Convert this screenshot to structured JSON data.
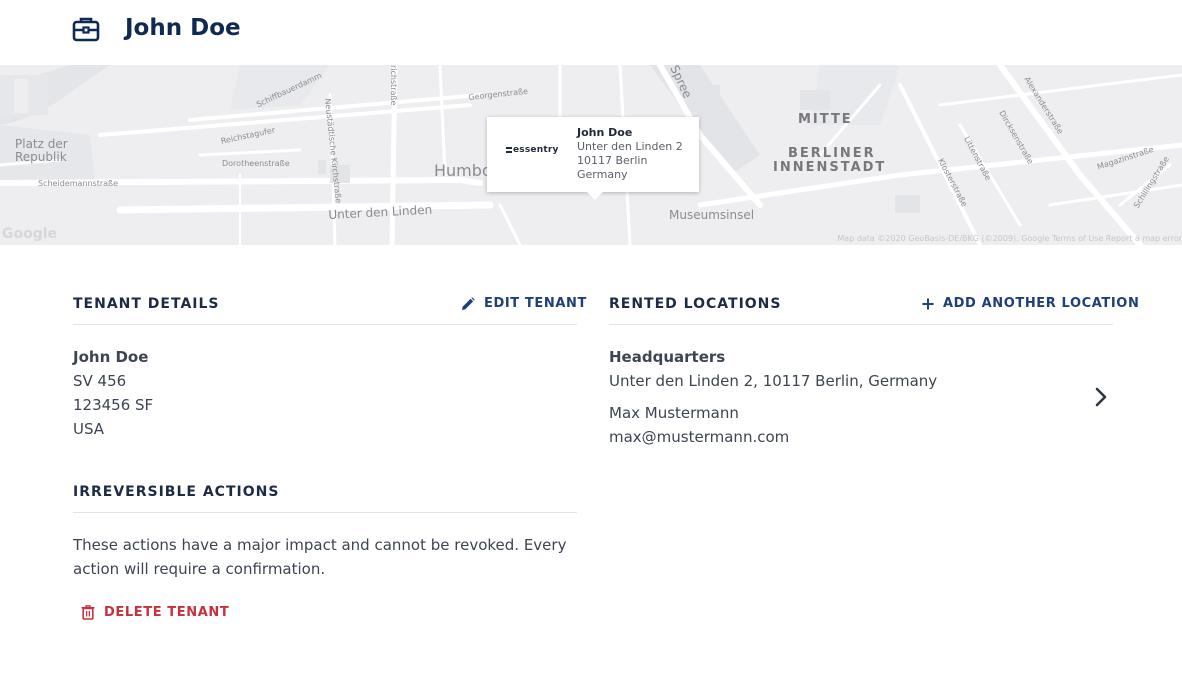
{
  "header": {
    "title": "John Doe",
    "icon": "briefcase-icon"
  },
  "map": {
    "labels": {
      "schiffbauerdamm": "Schiffbauerdamm",
      "friedrichstrasse": "richstraße",
      "georgenstrasse": "Georgenstraße",
      "spree": "Spree",
      "reichstagufer": "Reichstagufer",
      "neustaedtische": "Neustädtische Kirchstraße",
      "platz_der_republik": "Platz der Republik",
      "dorotheenstrasse": "Dorotheenstraße",
      "scheidemannstrasse": "Scheidemannstraße",
      "humboldt": "Humbo",
      "unter_den_linden": "Unter den Linden",
      "museumsinsel": "Museumsinsel",
      "mitte": "MITTE",
      "berliner": "BERLINER",
      "innenstadt": "INNENSTADT",
      "alexanderstrasse": "Alexanderstraße",
      "dircksenstrasse": "Dircksenstraße",
      "littenstrasse": "Littenstraße",
      "klosterstrasse": "Klosterstraße",
      "magazinstrasse": "Magazinstraße",
      "schillingstrasse": "Schillingstraße",
      "google": "Google",
      "copyright": "Map data ©2020 GeoBasis-DE/BKG (©2009), Google    Terms of Use    Report a map error"
    },
    "popup": {
      "logo_text": "essentry",
      "name": "John Doe",
      "address_line1": "Unter den Linden 2",
      "address_line2": "10117 Berlin",
      "address_line3": "Germany"
    }
  },
  "tenant_details": {
    "title": "TENANT DETAILS",
    "edit_label": "EDIT TENANT",
    "name": "John Doe",
    "line1": "SV 456",
    "line2": "123456 SF",
    "line3": "USA"
  },
  "irreversible": {
    "title": "IRREVERSIBLE ACTIONS",
    "description": "These actions have a major impact and cannot be revoked. Every action will require a confirmation.",
    "delete_label": "DELETE TENANT"
  },
  "rented_locations": {
    "title": "RENTED LOCATIONS",
    "add_label": "ADD ANOTHER LOCATION",
    "items": [
      {
        "name": "Headquarters",
        "address": "Unter den Linden 2, 10117 Berlin, Germany",
        "contact_name": "Max Mustermann",
        "contact_email": "max@mustermann.com"
      }
    ]
  },
  "colors": {
    "primary": "#0f2a52",
    "link": "#1f3f77",
    "danger": "#c7303d",
    "text": "#3d4452",
    "divider": "#e2e4e8"
  }
}
